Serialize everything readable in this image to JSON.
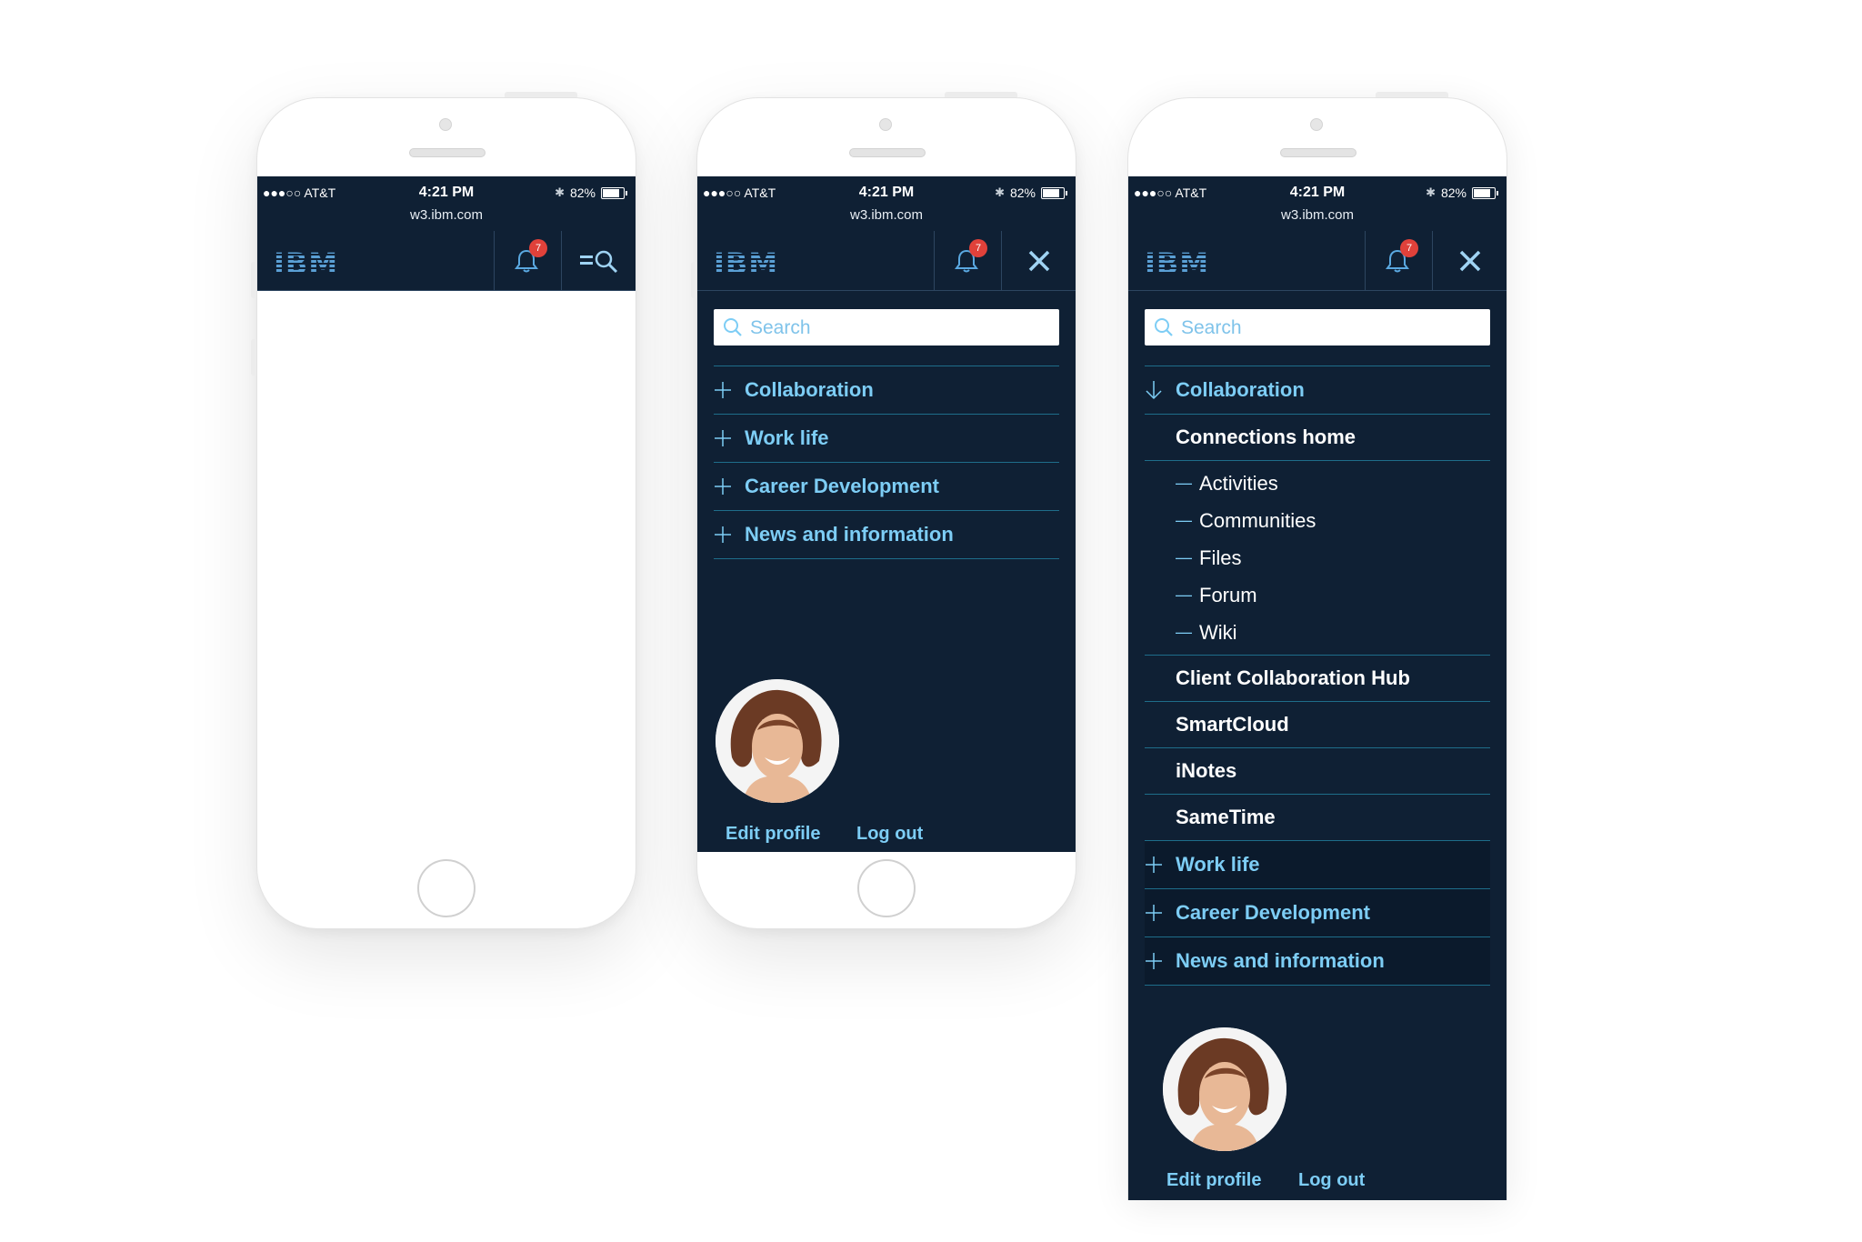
{
  "status": {
    "carrier": "●●●○○ AT&T",
    "time": "4:21 PM",
    "battery": "82%",
    "battery_level": 0.82,
    "url": "w3.ibm.com"
  },
  "header": {
    "logo": "IBM",
    "badge_count": "7"
  },
  "search": {
    "placeholder": "Search"
  },
  "nav": {
    "collaboration": "Collaboration",
    "work_life": "Work life",
    "career": "Career Development",
    "news": "News and information"
  },
  "collab_sub": {
    "connections_home": "Connections home",
    "leaves": [
      "Activities",
      "Communities",
      "Files",
      "Forum",
      "Wiki"
    ],
    "client_hub": "Client Collaboration Hub",
    "smartcloud": "SmartCloud",
    "inotes": "iNotes",
    "sametime": "SameTime"
  },
  "profile": {
    "edit": "Edit profile",
    "logout": "Log out"
  },
  "colors": {
    "navy": "#0f2034",
    "accent": "#7dcdf5",
    "badge": "#e0413a"
  }
}
